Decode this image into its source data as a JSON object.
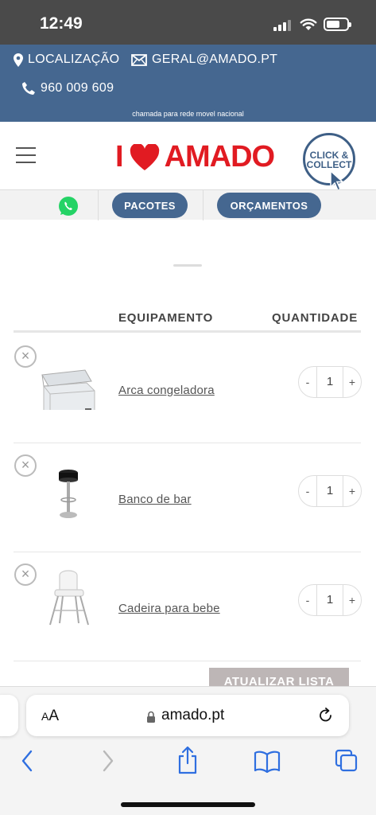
{
  "status_bar": {
    "time": "12:49"
  },
  "info_bar": {
    "location_label": "LOCALIZAÇÃO",
    "email_label": "GERAL@AMADO.PT",
    "phone_label": "960 009 609",
    "phone_note": "chamada para rede movel nacional"
  },
  "header": {
    "logo": {
      "prefix": "I",
      "suffix": "AMADO"
    },
    "click_collect": {
      "line1": "CLICK &",
      "line2": "COLLECT"
    }
  },
  "nav": {
    "pacotes_label": "PACOTES",
    "orcamentos_label": "ORÇAMENTOS"
  },
  "table": {
    "col_equipment": "EQUIPAMENTO",
    "col_quantity": "QUANTIDADE",
    "remove_symbol": "×",
    "minus_symbol": "-",
    "plus_symbol": "+",
    "rows": [
      {
        "name": "Arca congeladora",
        "qty": "1",
        "thumb_icon": "chest-freezer-image"
      },
      {
        "name": "Banco de bar",
        "qty": "1",
        "thumb_icon": "bar-stool-image"
      },
      {
        "name": "Cadeira para bebe",
        "qty": "1",
        "thumb_icon": "high-chair-image"
      }
    ],
    "update_button": "ATUALIZAR LISTA"
  },
  "browser": {
    "text_size_label_small": "A",
    "text_size_label_large": "A",
    "url": "amado.pt"
  },
  "colors": {
    "brand_blue": "#456790",
    "logo_red": "#e11b22",
    "update_button_bg": "#bdb6b6"
  }
}
